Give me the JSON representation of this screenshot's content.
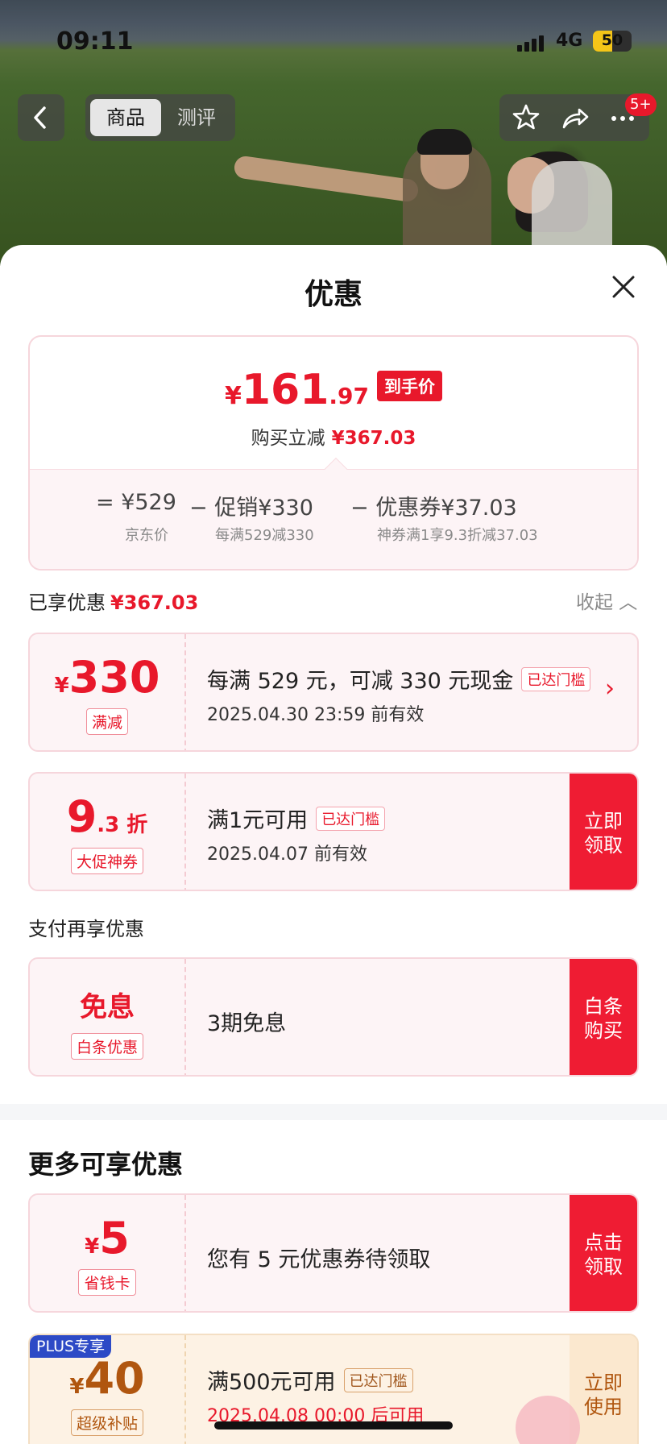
{
  "status_bar": {
    "time": "09:11",
    "network": "4G",
    "battery": "50",
    "battery_level": 0.5
  },
  "nav": {
    "tabs": [
      {
        "label": "商品"
      },
      {
        "label": "测评"
      }
    ],
    "badge": "5+"
  },
  "sheet": {
    "title": "优惠",
    "summary": {
      "yen": "¥",
      "price_int": "161",
      "price_dec": ".97",
      "final_tag": "到手价",
      "reduce_label": "购买立减",
      "reduce_value": "¥367.03",
      "jd_price": "= ¥529",
      "jd_label": "京东价",
      "promo": "− 促销¥330",
      "promo_detail": "每满529减330",
      "coupon": "− 优惠券¥37.03",
      "coupon_detail": "神券满1享9.3折减37.03"
    },
    "enjoyed": {
      "label": "已享优惠",
      "value": "¥367.03",
      "collapse": "收起 ︿"
    },
    "offers": [
      {
        "amount_yen": "¥",
        "amount": "330",
        "tag": "满减",
        "line1": "每满 529 元，可减 330 元现金",
        "pill": "已达门槛",
        "line2": "2025.04.30 23:59 前有效"
      },
      {
        "amount": "9",
        "amount_suffix": ".3 折",
        "tag": "大促神券",
        "line1": "满1元可用",
        "pill": "已达门槛",
        "line2": "2025.04.07 前有效",
        "action": "立即\n领取"
      }
    ],
    "pay_section": {
      "label": "支付再享优惠"
    },
    "pay_offer": {
      "amount": "免息",
      "tag": "白条优惠",
      "line1": "3期免息",
      "action": "白条\n购买"
    },
    "more": {
      "title": "更多可享优惠",
      "offers": [
        {
          "amount_yen": "¥",
          "amount": "5",
          "tag": "省钱卡",
          "line1": "您有 5 元优惠券待领取",
          "action": "点击\n领取"
        },
        {
          "plus_tag": "PLUS专享",
          "amount_yen": "¥",
          "amount": "40",
          "tag": "超级补贴",
          "line1": "满500元可用",
          "pill": "已达门槛",
          "line2": "2025.04.08 00:00 后可用",
          "action": "立即\n使用"
        }
      ]
    }
  },
  "colors": {
    "accent": "#e8182b",
    "plus": "#2d4ac6",
    "gold": "#b0560f"
  }
}
